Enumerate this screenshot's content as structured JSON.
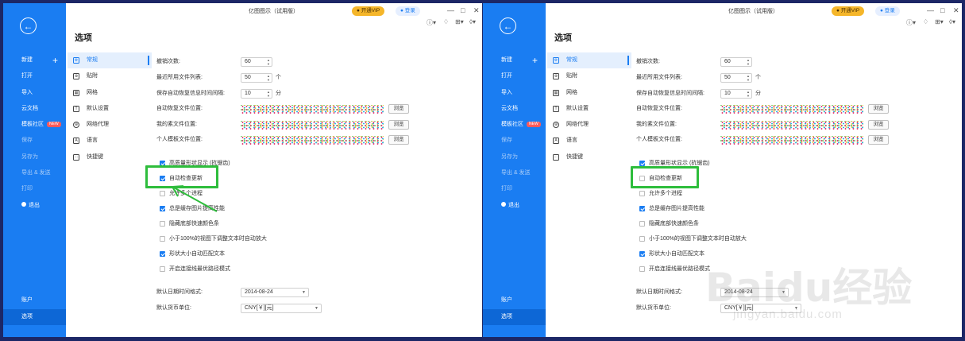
{
  "app": {
    "title": "亿图图示（试用版）",
    "vip_label": "开通VIP",
    "login_label": "登录",
    "page_title": "选项"
  },
  "sidebar": {
    "items": [
      {
        "label": "新建",
        "plus": "+"
      },
      {
        "label": "打开"
      },
      {
        "label": "导入"
      },
      {
        "label": "云文档"
      },
      {
        "label": "模板社区",
        "badge": "NEW"
      },
      {
        "label": "保存"
      },
      {
        "label": "另存为"
      },
      {
        "label": "导出 & 发送"
      },
      {
        "label": "打印"
      },
      {
        "label": "退出"
      }
    ],
    "bottom": [
      {
        "label": "账户"
      },
      {
        "label": "选项"
      }
    ]
  },
  "tabs": [
    {
      "label": "常规",
      "icon": "gear-doc-icon"
    },
    {
      "label": "贴附",
      "icon": "snap-icon"
    },
    {
      "label": "网格",
      "icon": "grid-icon"
    },
    {
      "label": "默认设置",
      "icon": "text-default-icon"
    },
    {
      "label": "网络代理",
      "icon": "globe-icon"
    },
    {
      "label": "语言",
      "icon": "language-icon"
    },
    {
      "label": "快捷键",
      "icon": "keyboard-icon"
    }
  ],
  "settings": {
    "undo_label": "撤销次数:",
    "undo_value": "60",
    "recent_label": "最近所用文件列表:",
    "recent_value": "50",
    "recent_unit": "个",
    "autosave_label": "保存自动恢复信息时间间隔:",
    "autosave_value": "10",
    "autosave_unit": "分",
    "autorecover_path_label": "自动恢复文件位置:",
    "myfiles_path_label": "我的素文件位置:",
    "mytemplates_path_label": "个人模板文件位置:",
    "browse_label": "浏览",
    "date_label": "默认日期时间格式:",
    "date_value": "2014-08-24",
    "currency_label": "默认货币单位:",
    "currency_value": "CNY[￥][元]"
  },
  "checkboxes_left": [
    {
      "label": "高质量形状显示 (抗锯齿)",
      "checked": true
    },
    {
      "label": "自动检查更新",
      "checked": true
    },
    {
      "label": "允许多个进程",
      "checked": false
    },
    {
      "label": "总是缓存图片提高性能",
      "checked": true
    },
    {
      "label": "隐藏底部快速颜色条",
      "checked": false
    },
    {
      "label": "小于100%的视图下调整文本时自动放大",
      "checked": false
    },
    {
      "label": "形状大小自动匹配文本",
      "checked": true
    },
    {
      "label": "开启连接线最优路径模式",
      "checked": false
    }
  ],
  "checkboxes_right": [
    {
      "label": "高质量形状显示 (抗锯齿)",
      "checked": true
    },
    {
      "label": "自动检查更新",
      "checked": false
    },
    {
      "label": "允许多个进程",
      "checked": false
    },
    {
      "label": "总是缓存图片提高性能",
      "checked": true
    },
    {
      "label": "隐藏底部快速颜色条",
      "checked": false
    },
    {
      "label": "小于100%的视图下调整文本时自动放大",
      "checked": false
    },
    {
      "label": "形状大小自动匹配文本",
      "checked": true
    },
    {
      "label": "开启连接线最优路径模式",
      "checked": false
    }
  ],
  "watermark": {
    "main": "Baidu经验",
    "sub": "jingyan.baidu.com"
  },
  "colors": {
    "sidebar": "#1a7df2",
    "highlight": "#2ebd3c",
    "vip": "#f5b62a"
  }
}
